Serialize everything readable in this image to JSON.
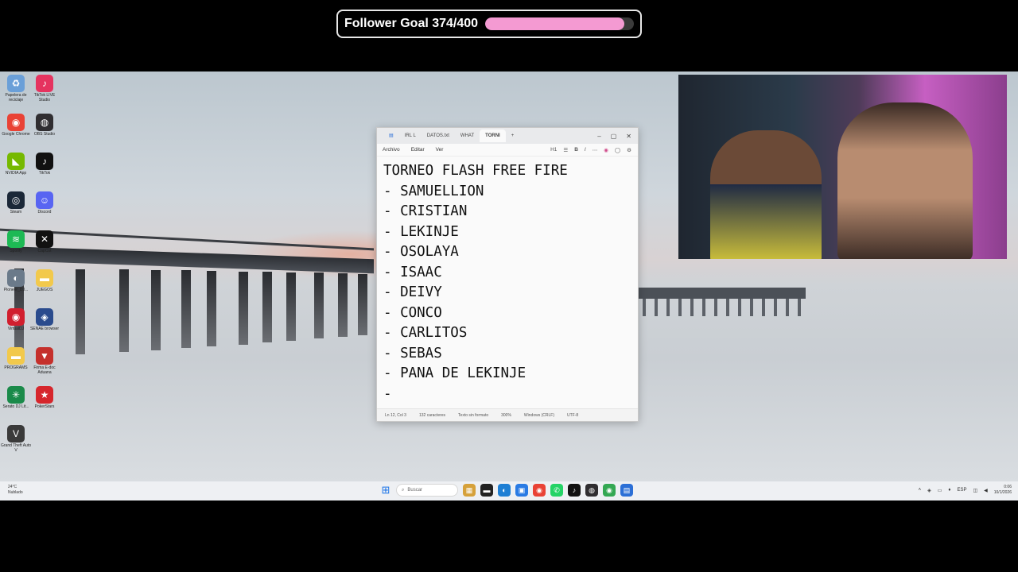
{
  "overlay": {
    "goal_text": "Follower Goal 374/400",
    "goal_current": 374,
    "goal_target": 400,
    "goal_fill_color": "#f49ad2"
  },
  "desktop_icons": [
    {
      "name": "recycle-bin-icon",
      "glyph": "♻",
      "color": "#6a9fd8",
      "label": "Papelera de reciclaje"
    },
    {
      "name": "tiktok-live-studio-icon",
      "glyph": "♪",
      "color": "#e5335f",
      "label": "TikTok LIVE Studio"
    },
    {
      "name": "google-chrome-icon",
      "glyph": "◉",
      "color": "#e94235",
      "label": "Google Chrome"
    },
    {
      "name": "obs-studio-icon",
      "glyph": "◍",
      "color": "#302e31",
      "label": "OBS Studio"
    },
    {
      "name": "nvidia-app-icon",
      "glyph": "◣",
      "color": "#76b900",
      "label": "NVIDIA App"
    },
    {
      "name": "tiktok-icon",
      "glyph": "♪",
      "color": "#111111",
      "label": "TikTok"
    },
    {
      "name": "steam-icon",
      "glyph": "◎",
      "color": "#1b2838",
      "label": "Steam"
    },
    {
      "name": "discord-icon",
      "glyph": "☺",
      "color": "#5865f2",
      "label": "Discord"
    },
    {
      "name": "spotify-icon",
      "glyph": "≋",
      "color": "#1db954",
      "label": "Spotify"
    },
    {
      "name": "capcut-icon",
      "glyph": "✕",
      "color": "#111111",
      "label": "CapCut"
    },
    {
      "name": "pioneer-dj-icon",
      "glyph": "◐",
      "color": "#6b7a8a",
      "label": "Pioneer_DJ..."
    },
    {
      "name": "juegos-folder-icon",
      "glyph": "▬",
      "color": "#f2c94c",
      "label": "JUEGOS"
    },
    {
      "name": "virtual-dj-icon",
      "glyph": "◉",
      "color": "#d11f2e",
      "label": "VirtualDJ"
    },
    {
      "name": "sena-browser-icon",
      "glyph": "◈",
      "color": "#2a4b8d",
      "label": "SENAE browser"
    },
    {
      "name": "programs-folder-icon",
      "glyph": "▬",
      "color": "#f2c94c",
      "label": "PROGRAMS"
    },
    {
      "name": "firma-e-doc-icon",
      "glyph": "▼",
      "color": "#c5302c",
      "label": "Firma E-doc Aduana"
    },
    {
      "name": "serato-dj-icon",
      "glyph": "✳",
      "color": "#1a8a4a",
      "label": "Serato DJ Lit..."
    },
    {
      "name": "pokerstars-icon",
      "glyph": "★",
      "color": "#d6262c",
      "label": "PokerStars"
    },
    {
      "name": "gta-v-icon",
      "glyph": "V",
      "color": "#3a3a3a",
      "label": "Grand Theft Auto V"
    }
  ],
  "notepad": {
    "tabs": [
      "IRL L",
      "DATOS.txt",
      "WHAT",
      "TORNI"
    ],
    "active_tab": "TORNI",
    "menu": [
      "Archivo",
      "Editar",
      "Ver"
    ],
    "heading_dropdown": "H1",
    "lines": [
      "TORNEO FLASH FREE FIRE",
      "- SAMUELLION",
      "- CRISTIAN",
      "- LEKINJE",
      "- OSOLAYA",
      "- ISAAC",
      "- DEIVY",
      "- CONCO",
      "- CARLITOS",
      "- SEBAS",
      "- PANA DE LEKINJE",
      "-"
    ],
    "status": {
      "position": "Ln 12, Col 3",
      "chars": "132 caracteres",
      "format": "Texto sin formato",
      "zoom": "300%",
      "eol": "Windows (CRLF)",
      "encoding": "UTF-8"
    }
  },
  "taskbar": {
    "weather_temp": "24°C",
    "weather_desc": "Nublado",
    "search_placeholder": "Buscar",
    "language": "ESP",
    "time": "0:06",
    "date": "10/1/2026"
  }
}
